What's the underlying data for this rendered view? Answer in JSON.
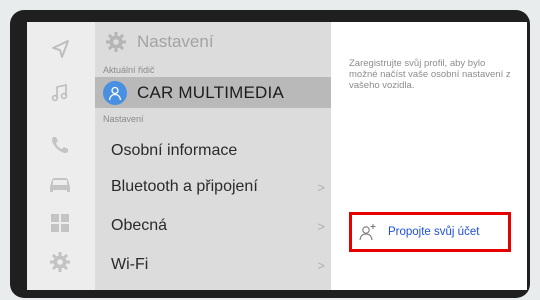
{
  "menu": {
    "title": "Nastavení",
    "current_driver_label": "Aktuální řidič",
    "driver_name": "CAR MULTIMEDIA",
    "settings_label": "Nastavení",
    "items": [
      {
        "label": "Osobní informace",
        "chevron": ""
      },
      {
        "label": "Bluetooth a připojení",
        "chevron": ">"
      },
      {
        "label": "Obecná",
        "chevron": ">"
      },
      {
        "label": "Wi-Fi",
        "chevron": ">"
      }
    ]
  },
  "panel": {
    "description": "Zaregistrujte svůj profil, aby bylo možné načíst vaše osobní nastavení z vašeho vozidla.",
    "link_account_label": "Propojte svůj účet"
  },
  "rail": {
    "icons": [
      "navigation-icon",
      "music-icon",
      "phone-icon",
      "car-icon",
      "apps-icon",
      "settings-icon"
    ]
  },
  "colors": {
    "highlight": "#e50000",
    "link": "#1f4fd6",
    "avatar": "#4a90e2"
  }
}
